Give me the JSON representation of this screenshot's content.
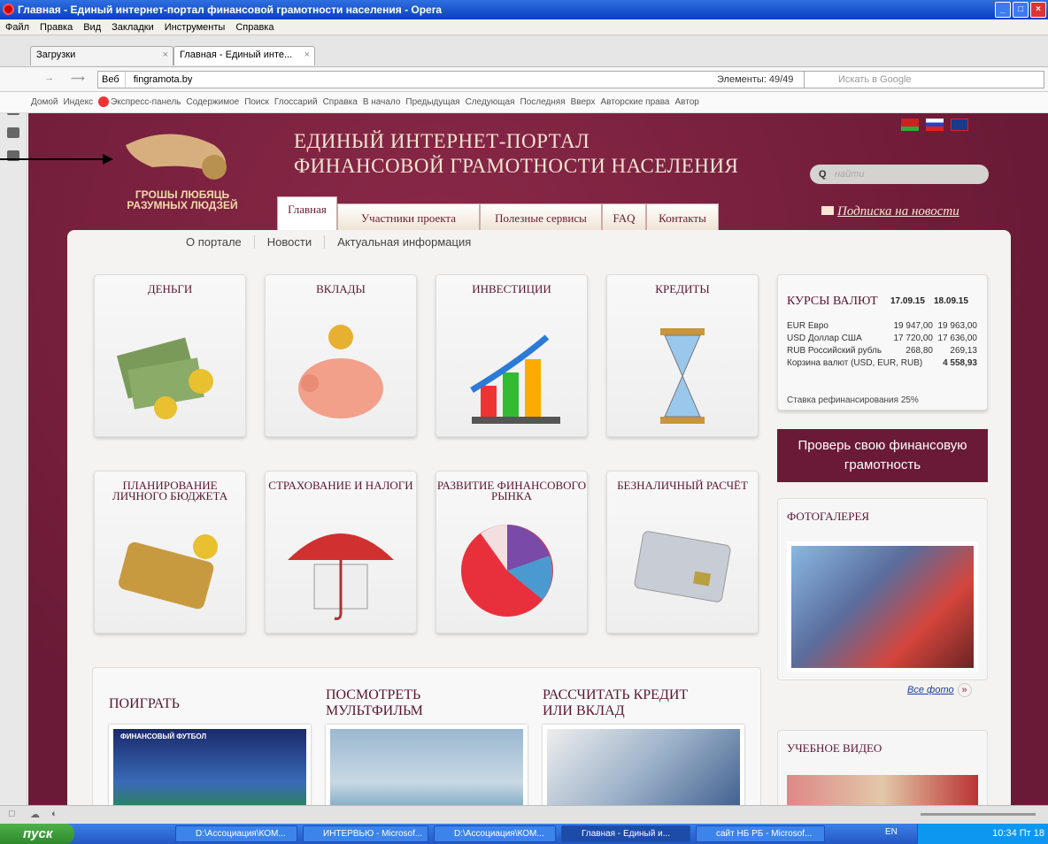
{
  "window": {
    "title": "Главная - Единый интернет-портал финансовой грамотности населения - Opera"
  },
  "menu": [
    "Файл",
    "Правка",
    "Вид",
    "Закладки",
    "Инструменты",
    "Справка"
  ],
  "tabs": [
    {
      "label": "Загрузки",
      "active": false
    },
    {
      "label": "Главная - Единый инте...",
      "active": true
    }
  ],
  "address": {
    "prefix": "Веб",
    "url": "fingramota.by",
    "elements": "Элементы: 49/49",
    "search_placeholder": "Искать в Google"
  },
  "navlinks": [
    "Домой",
    "Индекс",
    "Экспресс-панель",
    "Содержимое",
    "Поиск",
    "Глоссарий",
    "Справка",
    "В начало",
    "Предыдущая",
    "Следующая",
    "Последняя",
    "Вверх",
    "Авторские права",
    "Автор"
  ],
  "site": {
    "logo_line1": "ГРОШЫ ЛЮБЯЦЬ",
    "logo_line2": "РАЗУМНЫХ ЛЮДЗЕЙ",
    "title_line1": "ЕДИНЫЙ ИНТЕРНЕТ-ПОРТАЛ",
    "title_line2": "ФИНАНСОВОЙ ГРАМОТНОСТИ НАСЕЛЕНИЯ",
    "search_placeholder": "найти",
    "subscribe": "Подписка на новости",
    "main_tabs": [
      "Главная",
      "Участники проекта",
      "Полезные сервисы",
      "FAQ",
      "Контакты"
    ],
    "subnav": [
      "О портале",
      "Новости",
      "Актуальная информация"
    ]
  },
  "tiles": [
    {
      "title": "ДЕНЬГИ",
      "icon": "money-icon"
    },
    {
      "title": "ВКЛАДЫ",
      "icon": "piggy-bank-icon"
    },
    {
      "title": "ИНВЕСТИЦИИ",
      "icon": "bar-growth-icon"
    },
    {
      "title": "КРЕДИТЫ",
      "icon": "hourglass-icon"
    },
    {
      "title": "ПЛАНИРОВАНИЕ ЛИЧНОГО БЮДЖЕТА",
      "icon": "wallet-icon"
    },
    {
      "title": "СТРАХОВАНИЕ И НАЛОГИ",
      "icon": "umbrella-house-icon"
    },
    {
      "title": "РАЗВИТИЕ ФИНАНСОВОГО РЫНКА",
      "icon": "pie-icon"
    },
    {
      "title": "БЕЗНАЛИЧНЫЙ РАСЧЁТ",
      "icon": "card-icon"
    }
  ],
  "rates": {
    "title": "КУРСЫ ВАЛЮТ",
    "date1": "17.09.15",
    "date2": "18.09.15",
    "rows": [
      {
        "name": "EUR Евро",
        "v1": "19 947,00",
        "v2": "19 963,00"
      },
      {
        "name": "USD Доллар США",
        "v1": "17 720,00",
        "v2": "17 636,00"
      },
      {
        "name": "RUB Российский рубль",
        "v1": "268,80",
        "v2": "269,13"
      },
      {
        "name": "Корзина валют (USD, EUR, RUB)",
        "v1": "",
        "v2": "4 558,93"
      }
    ],
    "refinance": "Ставка рефинансирования 25%"
  },
  "check_button": "Проверь свою финансовую грамотность",
  "gallery": {
    "title": "ФОТОГАЛЕРЕЯ",
    "all_photos": "Все фото"
  },
  "video": {
    "title": "УЧЕБНОЕ ВИДЕО"
  },
  "promo": [
    {
      "title": "ПОИГРАТЬ",
      "banner": "ФИНАНСОВЫЙ ФУТБОЛ"
    },
    {
      "title": "ПОСМОТРЕТЬ МУЛЬТФИЛЬМ"
    },
    {
      "title": "РАССЧИТАТЬ КРЕДИТ ИЛИ ВКЛАД"
    }
  ],
  "taskbar": {
    "start": "пуск",
    "items": [
      "D:\\Ассоциация\\КОМ...",
      "ИНТЕРВЬЮ - Microsof...",
      "D:\\Ассоциация\\КОМ...",
      "Главная - Единый и...",
      "сайт НБ РБ - Microsof..."
    ],
    "lang": "EN",
    "clock": "10:34 Пт 18"
  },
  "colors": {
    "brand": "#6a1a36",
    "accent_text": "#5a1530"
  }
}
